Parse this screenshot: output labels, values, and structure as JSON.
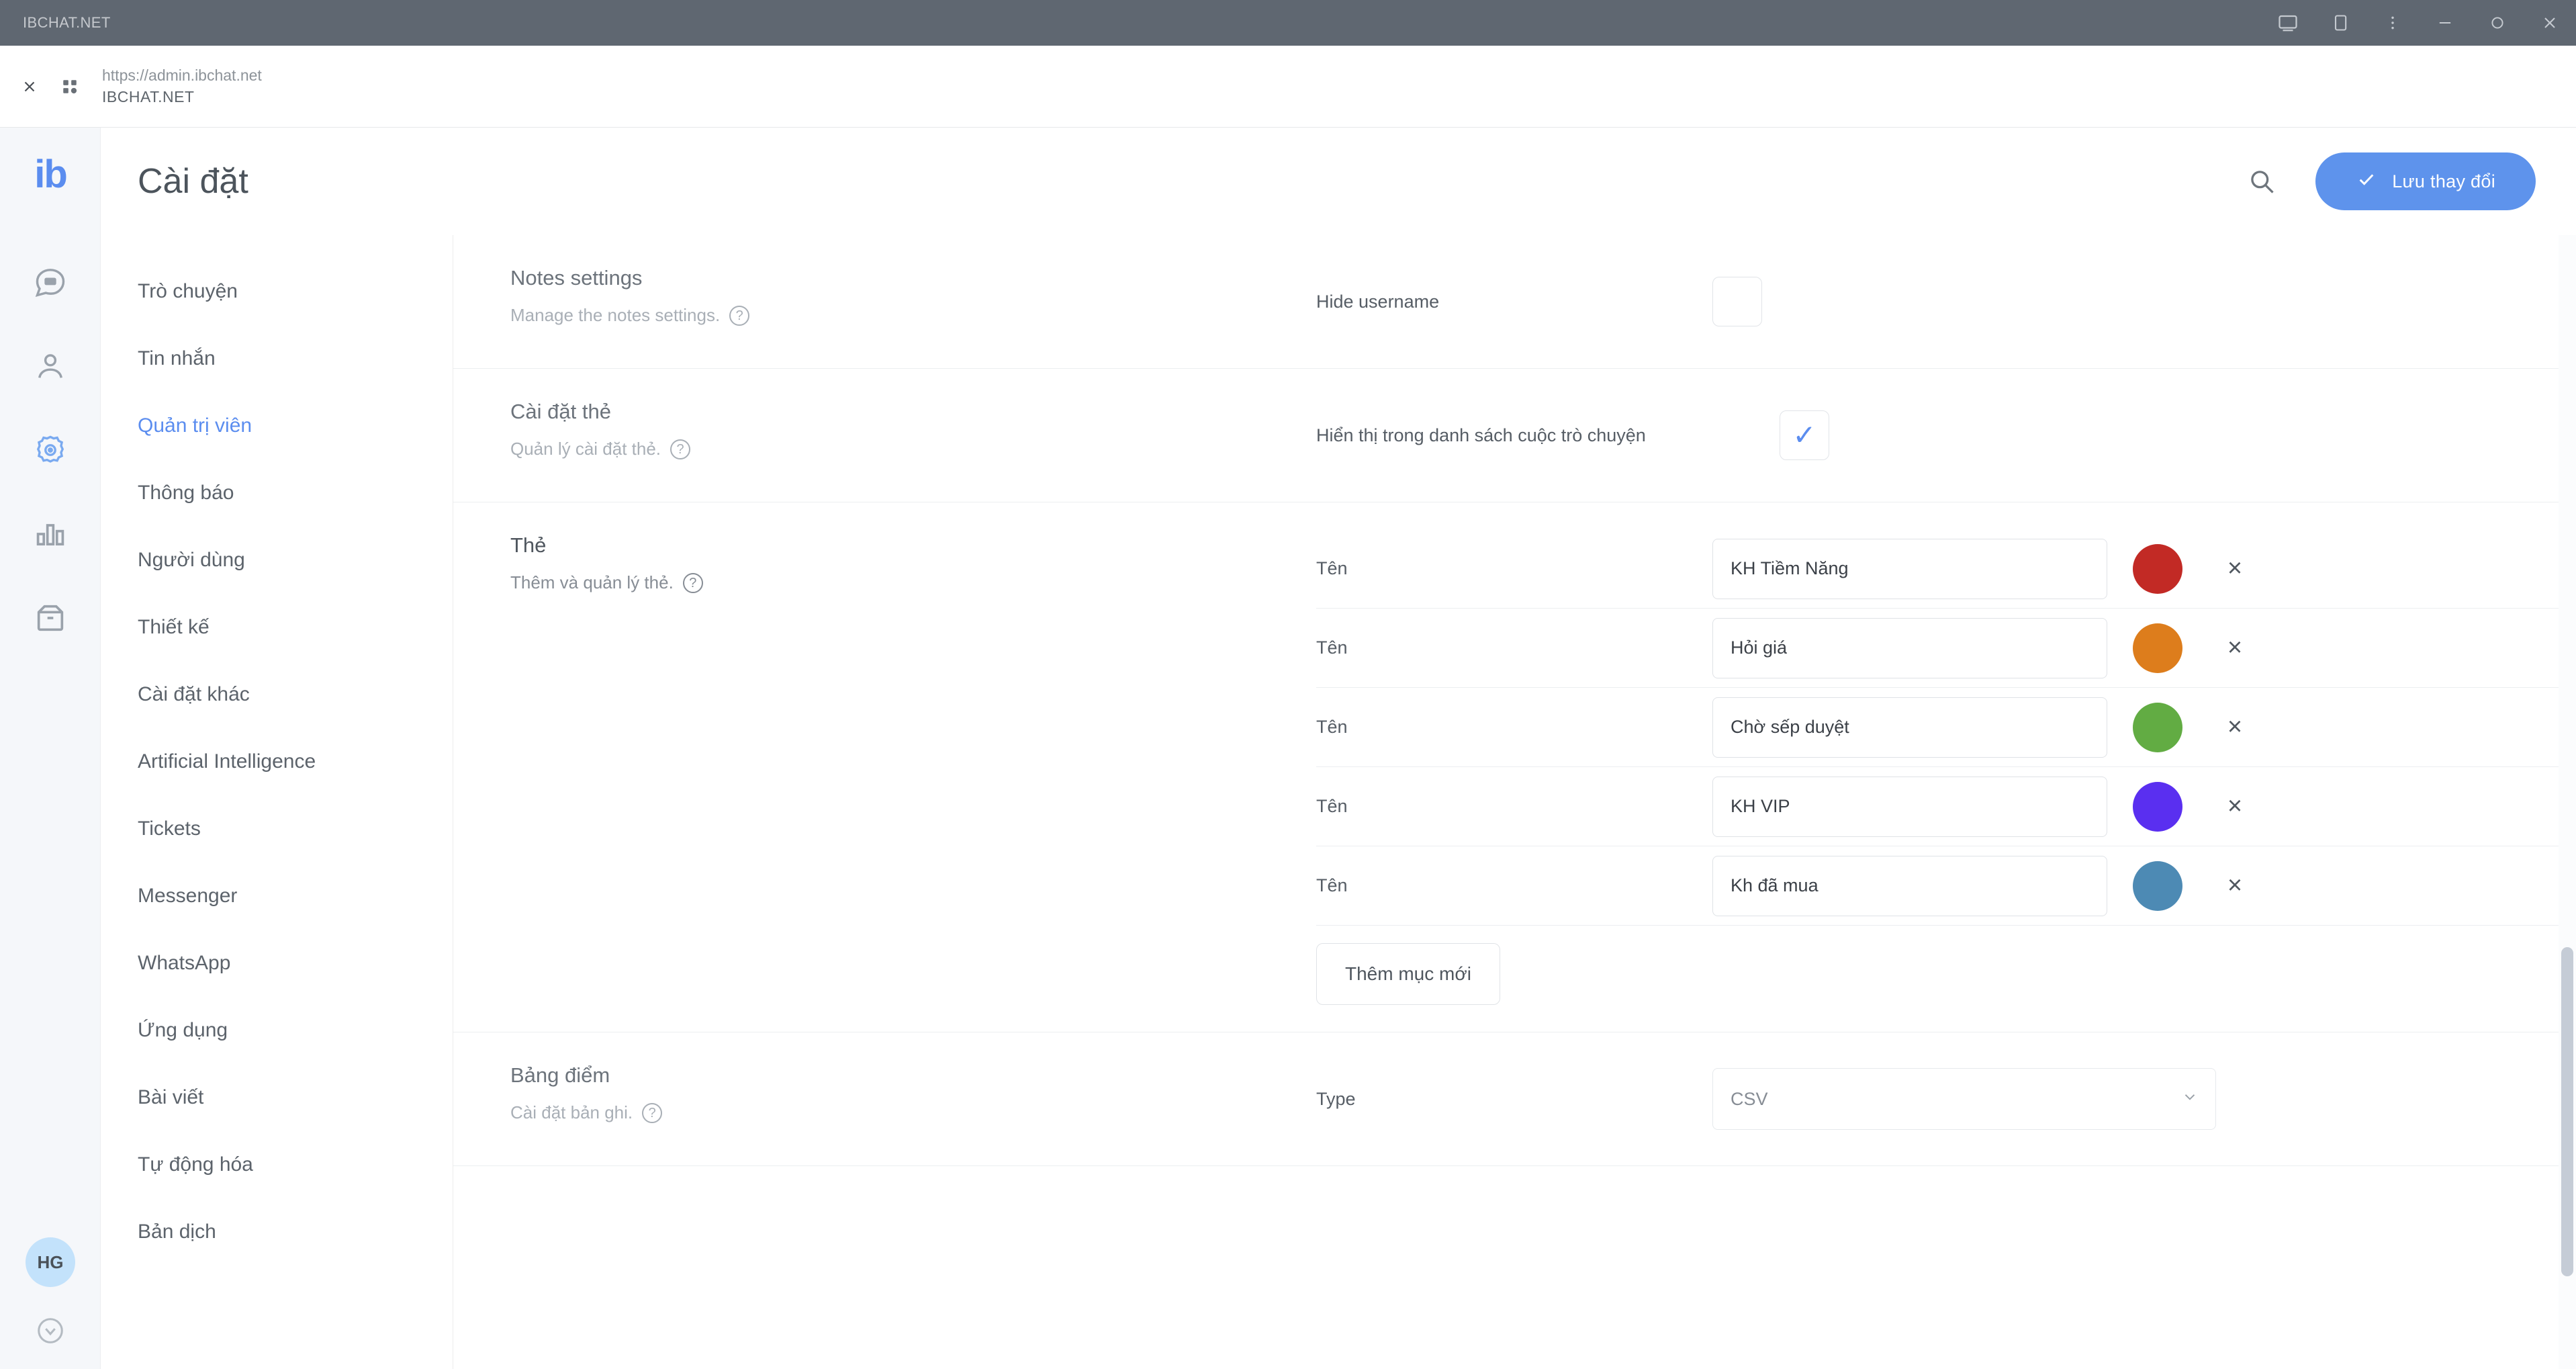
{
  "window": {
    "title": "IBCHAT.NET",
    "controls": [
      {
        "name": "cast-icon",
        "glyph": "cast"
      },
      {
        "name": "copy-icon",
        "glyph": "copy"
      },
      {
        "name": "more-menu-icon",
        "glyph": "kebab"
      },
      {
        "name": "minimize-icon",
        "glyph": "minimize"
      },
      {
        "name": "maximize-icon",
        "glyph": "maximize"
      },
      {
        "name": "close-icon",
        "glyph": "close"
      }
    ]
  },
  "browser": {
    "close_label": "×",
    "url": "https://admin.ibchat.net",
    "site_name": "IBCHAT.NET"
  },
  "rail": {
    "logo": "ib",
    "items": [
      {
        "name": "chat-icon",
        "active": false
      },
      {
        "name": "contacts-icon",
        "active": false
      },
      {
        "name": "settings-icon",
        "active": true
      },
      {
        "name": "reports-icon",
        "active": false
      },
      {
        "name": "archive-icon",
        "active": false
      }
    ],
    "avatar_initials": "HG",
    "help_icon": "help-icon"
  },
  "header": {
    "title": "Cài đặt",
    "search_icon": "search-icon",
    "save_label": "Lưu thay đổi",
    "accent_color": "#5e93ec"
  },
  "nav": {
    "items": [
      {
        "label": "Trò chuyện",
        "active": false
      },
      {
        "label": "Tin nhắn",
        "active": false
      },
      {
        "label": "Quản trị viên",
        "active": true
      },
      {
        "label": "Thông báo",
        "active": false
      },
      {
        "label": "Người dùng",
        "active": false
      },
      {
        "label": "Thiết kế",
        "active": false
      },
      {
        "label": "Cài đặt khác",
        "active": false
      },
      {
        "label": "Artificial Intelligence",
        "active": false
      },
      {
        "label": "Tickets",
        "active": false
      },
      {
        "label": "Messenger",
        "active": false
      },
      {
        "label": "WhatsApp",
        "active": false
      },
      {
        "label": "Ứng dụng",
        "active": false
      },
      {
        "label": "Bài viết",
        "active": false
      },
      {
        "label": "Tự động hóa",
        "active": false
      },
      {
        "label": "Bản dịch",
        "active": false
      }
    ]
  },
  "sections": {
    "notes": {
      "title": "Notes settings",
      "desc": "Manage the notes settings.",
      "field_label": "Hide username",
      "checked": false
    },
    "card_settings": {
      "title": "Cài đặt thẻ",
      "desc": "Quản lý cài đặt thẻ.",
      "field_label": "Hiển thị trong danh sách cuộc trò chuyện",
      "checked": true,
      "check_glyph": "✓"
    },
    "tags": {
      "title": "Thẻ",
      "desc": "Thêm và quản lý thẻ.",
      "name_label": "Tên",
      "remove_glyph": "×",
      "add_label": "Thêm mục mới",
      "rows": [
        {
          "value": "KH Tiềm Năng",
          "color": "#c22a25"
        },
        {
          "value": "Hỏi giá",
          "color": "#dd7d1c"
        },
        {
          "value": "Chờ sếp duyệt",
          "color": "#62ac43"
        },
        {
          "value": "KH VIP",
          "color": "#5a2ff0"
        },
        {
          "value": "Kh đã mua",
          "color": "#4d8ab4"
        }
      ]
    },
    "scoreboard": {
      "title": "Bảng điểm",
      "desc": "Cài đặt bản ghi.",
      "type_label": "Type",
      "type_value": "CSV",
      "caret_glyph": "⌄"
    }
  }
}
